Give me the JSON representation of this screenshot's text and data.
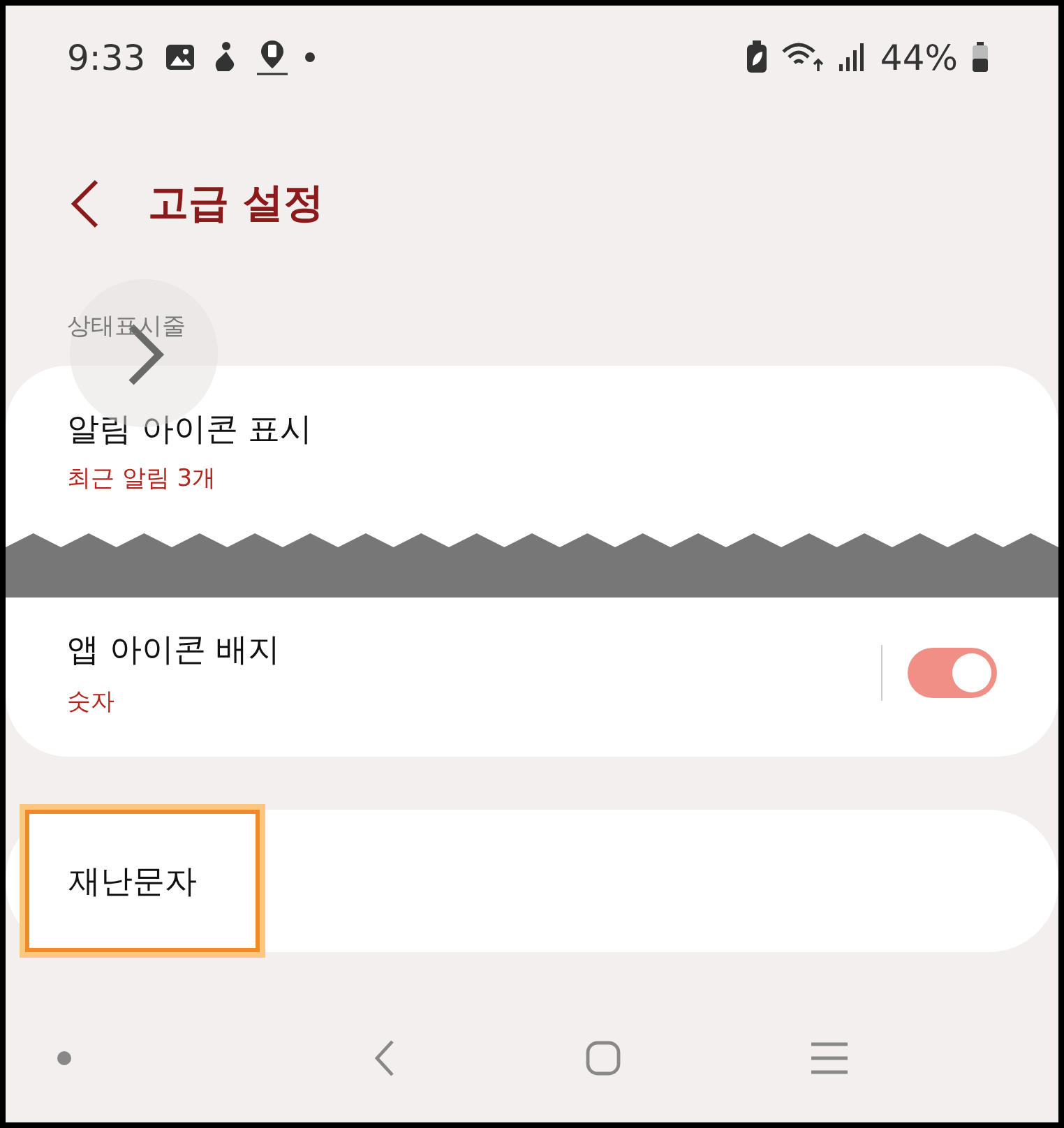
{
  "status_bar": {
    "time": "9:33",
    "battery": "44%"
  },
  "header": {
    "title": "고급 설정"
  },
  "section": {
    "label": "상태표시줄"
  },
  "card": {
    "items": [
      {
        "kind": "link",
        "title": "알림 아이콘 표시",
        "subtitle": "최근 알림 3개"
      },
      {
        "kind": "toggle",
        "title": "앱 아이콘 배지",
        "subtitle": "숫자",
        "on": true
      }
    ]
  },
  "single": {
    "title": "재난문자",
    "highlighted": true
  }
}
